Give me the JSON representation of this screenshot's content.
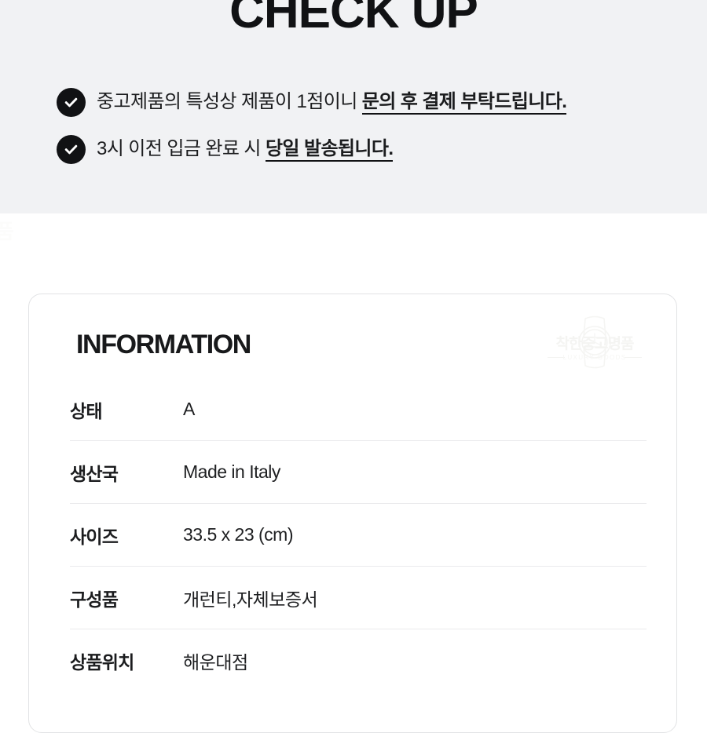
{
  "checkup": {
    "title": "CHECK UP",
    "items": [
      {
        "icon": "check-circle-icon",
        "text_plain": "중고제품의 특성상 제품이 1점이니 ",
        "text_emphasis": "문의 후 결제 부탁드립니다."
      },
      {
        "icon": "check-circle-icon",
        "text_plain": "3시 이전 입금 완료 시 ",
        "text_emphasis": "당일 발송됩니다."
      }
    ]
  },
  "edge_mark": "품",
  "information_card": {
    "heading": "INFORMATION",
    "watermark": {
      "brand": "착한중고명품",
      "tagline": "LUXURY GOODS",
      "icon": "watch-logo-icon"
    },
    "rows": [
      {
        "label": "상태",
        "value": "A"
      },
      {
        "label": "생산국",
        "value": "Made in Italy"
      },
      {
        "label": "사이즈",
        "value": "33.5 x 23 (cm)"
      },
      {
        "label": "구성품",
        "value": "개런티,자체보증서"
      },
      {
        "label": "상품위치",
        "value": "해운대점"
      }
    ]
  },
  "colors": {
    "banner_background": "#f1f2f4",
    "page_background": "#ffffff",
    "text_primary": "#111214",
    "card_border": "#e2e3e5",
    "divider": "#eaeaec",
    "icon_fill": "#111214"
  }
}
